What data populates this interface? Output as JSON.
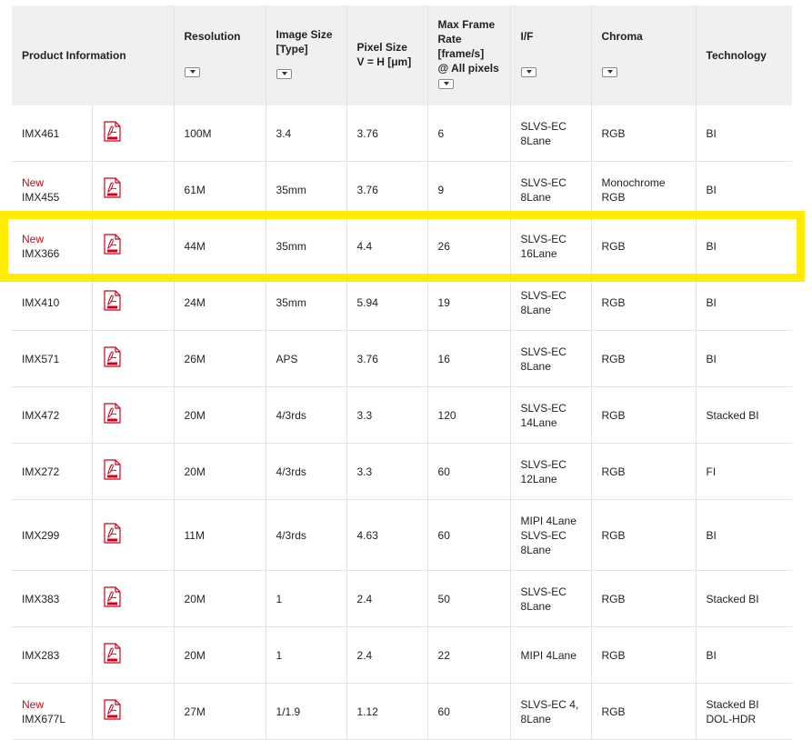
{
  "headers": {
    "product": "Product Information",
    "resolution": "Resolution",
    "image_size_1": "Image Size",
    "image_size_2": "[Type]",
    "pixel_size_1": "Pixel Size",
    "pixel_size_2": "V = H [μm]",
    "frame_rate_1": "Max Frame",
    "frame_rate_2": "Rate",
    "frame_rate_3": "[frame/s]",
    "frame_rate_4": "@ All pixels",
    "interface": "I/F",
    "chroma": "Chroma",
    "technology": "Technology"
  },
  "new_label": "New",
  "rows": [
    {
      "new": false,
      "model": "IMX461",
      "res": "100M",
      "size": "3.4",
      "pixel": "3.76",
      "fps": "6",
      "if1": "SLVS-EC",
      "if2": "8Lane",
      "if3": "",
      "chroma1": "RGB",
      "chroma2": "",
      "tech1": "BI",
      "tech2": ""
    },
    {
      "new": true,
      "model": "IMX455",
      "res": "61M",
      "size": "35mm",
      "pixel": "3.76",
      "fps": "9",
      "if1": "SLVS-EC",
      "if2": "8Lane",
      "if3": "",
      "chroma1": "Monochrome",
      "chroma2": "RGB",
      "tech1": "BI",
      "tech2": ""
    },
    {
      "new": true,
      "model": "IMX366",
      "res": "44M",
      "size": "35mm",
      "pixel": "4.4",
      "fps": "26",
      "if1": "SLVS-EC",
      "if2": "16Lane",
      "if3": "",
      "chroma1": "RGB",
      "chroma2": "",
      "tech1": "BI",
      "tech2": ""
    },
    {
      "new": false,
      "model": "IMX410",
      "res": "24M",
      "size": "35mm",
      "pixel": "5.94",
      "fps": "19",
      "if1": "SLVS-EC",
      "if2": "8Lane",
      "if3": "",
      "chroma1": "RGB",
      "chroma2": "",
      "tech1": "BI",
      "tech2": ""
    },
    {
      "new": false,
      "model": "IMX571",
      "res": "26M",
      "size": "APS",
      "pixel": "3.76",
      "fps": "16",
      "if1": "SLVS-EC",
      "if2": "8Lane",
      "if3": "",
      "chroma1": "RGB",
      "chroma2": "",
      "tech1": "BI",
      "tech2": ""
    },
    {
      "new": false,
      "model": "IMX472",
      "res": "20M",
      "size": "4/3rds",
      "pixel": "3.3",
      "fps": "120",
      "if1": "SLVS-EC",
      "if2": "14Lane",
      "if3": "",
      "chroma1": "RGB",
      "chroma2": "",
      "tech1": "Stacked BI",
      "tech2": ""
    },
    {
      "new": false,
      "model": "IMX272",
      "res": "20M",
      "size": "4/3rds",
      "pixel": "3.3",
      "fps": "60",
      "if1": "SLVS-EC",
      "if2": "12Lane",
      "if3": "",
      "chroma1": "RGB",
      "chroma2": "",
      "tech1": "FI",
      "tech2": ""
    },
    {
      "new": false,
      "model": "IMX299",
      "res": "11M",
      "size": "4/3rds",
      "pixel": "4.63",
      "fps": "60",
      "if1": "MIPI 4Lane",
      "if2": "SLVS-EC",
      "if3": "8Lane",
      "chroma1": "RGB",
      "chroma2": "",
      "tech1": "BI",
      "tech2": ""
    },
    {
      "new": false,
      "model": "IMX383",
      "res": "20M",
      "size": "1",
      "pixel": "2.4",
      "fps": "50",
      "if1": "SLVS-EC",
      "if2": "8Lane",
      "if3": "",
      "chroma1": "RGB",
      "chroma2": "",
      "tech1": "Stacked BI",
      "tech2": ""
    },
    {
      "new": false,
      "model": "IMX283",
      "res": "20M",
      "size": "1",
      "pixel": "2.4",
      "fps": "22",
      "if1": "MIPI 4Lane",
      "if2": "",
      "if3": "",
      "chroma1": "RGB",
      "chroma2": "",
      "tech1": "BI",
      "tech2": ""
    },
    {
      "new": true,
      "model": "IMX677L",
      "res": "27M",
      "size": "1/1.9",
      "pixel": "1.12",
      "fps": "60",
      "if1": "SLVS-EC 4,",
      "if2": "8Lane",
      "if3": "",
      "chroma1": "RGB",
      "chroma2": "",
      "tech1": "Stacked BI",
      "tech2": "DOL-HDR"
    }
  ],
  "colors": {
    "header_bg": "#f0f0f0",
    "new_tag": "#d0021b",
    "highlight": "#ffec00",
    "pdf_icon": "#d0021b"
  },
  "icons": {
    "pdf": "pdf-document-icon",
    "dropdown": "chevron-down-icon"
  },
  "highlighted_model": "IMX366"
}
